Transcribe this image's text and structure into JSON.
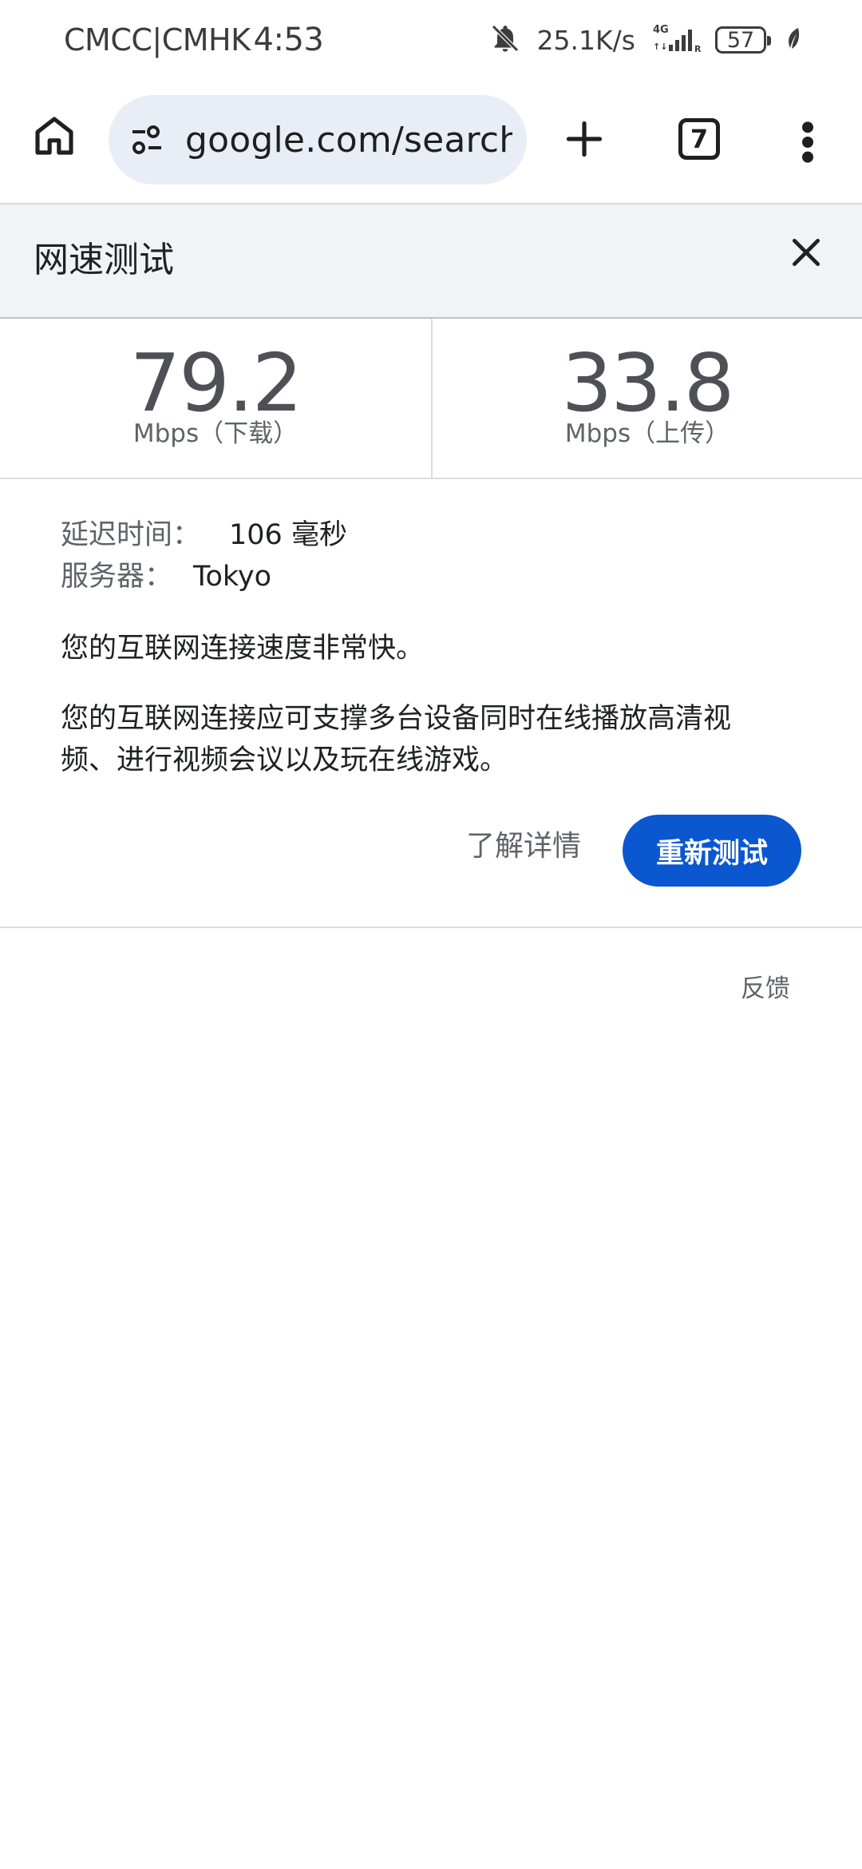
{
  "status_bar": {
    "carrier": "CMCC|CMHK",
    "time": "4:53",
    "net_speed": "25.1K/s",
    "battery_level": "57",
    "icons": [
      "bell-off-icon",
      "signal-4g-icon",
      "battery-icon",
      "leaf-icon"
    ]
  },
  "browser": {
    "url": "google.com/search?q",
    "tab_count": "7",
    "icons": [
      "home-icon",
      "site-settings-icon",
      "plus-icon",
      "more-vert-icon"
    ]
  },
  "speed_test": {
    "title": "网速测试",
    "download": {
      "value": "79.2",
      "unit": "Mbps（下载）"
    },
    "upload": {
      "value": "33.8",
      "unit": "Mbps（上传）"
    },
    "latency": {
      "label": "延迟时间：",
      "value": "106 毫秒"
    },
    "server": {
      "label": "服务器：",
      "value": "Tokyo"
    },
    "summary": "您的互联网连接速度非常快。",
    "description": "您的互联网连接应可支撑多台设备同时在线播放高清视频、进行视频会议以及玩在线游戏。",
    "learn_more_label": "了解详情",
    "retest_label": "重新测试",
    "feedback_label": "反馈"
  },
  "colors": {
    "accent": "#0b57d0",
    "omnibox_bg": "#e9eef6",
    "panel_header_bg": "#f1f3f4"
  }
}
